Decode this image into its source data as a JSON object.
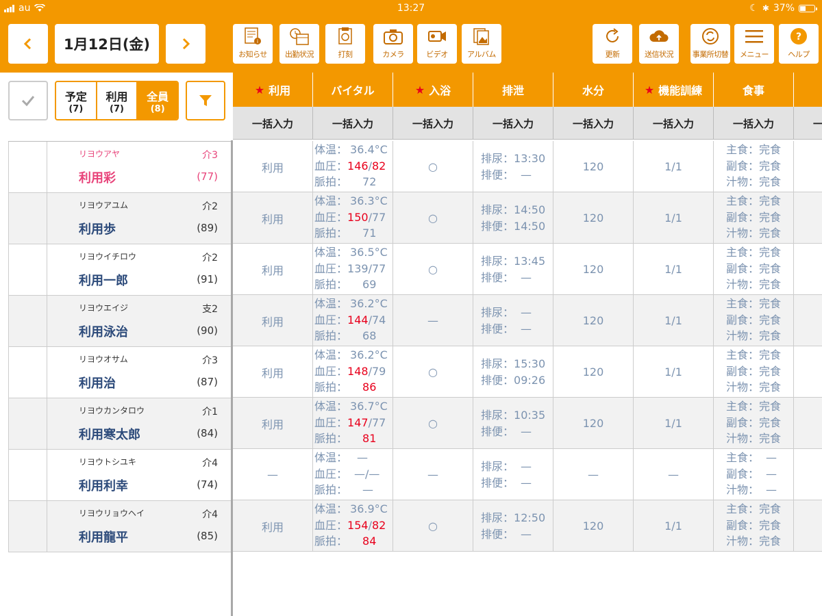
{
  "status": {
    "carrier": "au",
    "time": "13:27",
    "battery": "37%"
  },
  "date": "1月12日(金)",
  "toolbar": {
    "oshirase": "お知らせ",
    "shukkin": "出勤状況",
    "dakoku": "打刻",
    "camera": "カメラ",
    "video": "ビデオ",
    "album": "アルバム",
    "koshin": "更新",
    "soshin": "送信状況",
    "jigyosho": "事業所切替",
    "menu": "メニュー",
    "help": "ヘルプ"
  },
  "filter": {
    "yotei": "予定",
    "yotei_count": "(7)",
    "riyo": "利用",
    "riyo_count": "(7)",
    "zenin": "全員",
    "zenin_count": "(8)"
  },
  "columns": [
    "利用",
    "バイタル",
    "入浴",
    "排泄",
    "水分",
    "機能訓練",
    "食事",
    ""
  ],
  "bulk_label": "一括入力",
  "labels": {
    "taion": "体温：",
    "ketsuatsu": "血圧：",
    "myakuhaku": "脈拍：",
    "hainyo": "排尿：",
    "haiben": "排便：",
    "shushoku": "主食：",
    "fukushoku": "副食：",
    "jiru": "汁物："
  },
  "users": [
    {
      "kana": "リヨウアヤ",
      "care": "介3",
      "name": "利用彩",
      "age": "(77)",
      "use": "利用",
      "temp": "36.4°C",
      "bp_hi": "146",
      "bp_lo": "82",
      "pulse": "72",
      "bath": "○",
      "urine": "13:30",
      "stool": "—",
      "water": "120",
      "training": "1/1",
      "m1": "完食",
      "m2": "完食",
      "m3": "完食"
    },
    {
      "kana": "リヨウアユム",
      "care": "介2",
      "name": "利用歩",
      "age": "(89)",
      "use": "利用",
      "temp": "36.3°C",
      "bp_hi": "150",
      "bp_lo": "77",
      "pulse": "71",
      "bath": "○",
      "urine": "14:50",
      "stool": "14:50",
      "water": "120",
      "training": "1/1",
      "m1": "完食",
      "m2": "完食",
      "m3": "完食"
    },
    {
      "kana": "リヨウイチロウ",
      "care": "介2",
      "name": "利用一郎",
      "age": "(91)",
      "use": "利用",
      "temp": "36.5°C",
      "bp_hi": "139",
      "bp_lo": "77",
      "pulse": "69",
      "bath": "○",
      "urine": "13:45",
      "stool": "—",
      "water": "120",
      "training": "1/1",
      "m1": "完食",
      "m2": "完食",
      "m3": "完食"
    },
    {
      "kana": "リヨウエイジ",
      "care": "支2",
      "name": "利用泳治",
      "age": "(90)",
      "use": "利用",
      "temp": "36.2°C",
      "bp_hi": "144",
      "bp_lo": "74",
      "pulse": "68",
      "bath": "—",
      "urine": "—",
      "stool": "—",
      "water": "120",
      "training": "1/1",
      "m1": "完食",
      "m2": "完食",
      "m3": "完食"
    },
    {
      "kana": "リヨウオサム",
      "care": "介3",
      "name": "利用治",
      "age": "(87)",
      "use": "利用",
      "temp": "36.2°C",
      "bp_hi": "148",
      "bp_lo": "79",
      "pulse": "86",
      "bath": "○",
      "urine": "15:30",
      "stool": "09:26",
      "water": "120",
      "training": "1/1",
      "m1": "完食",
      "m2": "完食",
      "m3": "完食"
    },
    {
      "kana": "リヨウカンタロウ",
      "care": "介1",
      "name": "利用寒太郎",
      "age": "(84)",
      "use": "利用",
      "temp": "36.7°C",
      "bp_hi": "147",
      "bp_lo": "77",
      "pulse": "81",
      "bath": "○",
      "urine": "10:35",
      "stool": "—",
      "water": "120",
      "training": "1/1",
      "m1": "完食",
      "m2": "完食",
      "m3": "完食"
    },
    {
      "kana": "リヨウトシユキ",
      "care": "介4",
      "name": "利用利幸",
      "age": "(74)",
      "use": "—",
      "temp": "—",
      "bp_hi": "—",
      "bp_lo": "—",
      "pulse": "—",
      "bath": "—",
      "urine": "—",
      "stool": "—",
      "water": "—",
      "training": "—",
      "m1": "—",
      "m2": "—",
      "m3": "—"
    },
    {
      "kana": "リヨウリョウヘイ",
      "care": "介4",
      "name": "利用龍平",
      "age": "(85)",
      "use": "利用",
      "temp": "36.9°C",
      "bp_hi": "154",
      "bp_lo": "82",
      "pulse": "84",
      "bath": "○",
      "urine": "12:50",
      "stool": "—",
      "water": "120",
      "training": "1/1",
      "m1": "完食",
      "m2": "完食",
      "m3": "完食"
    }
  ]
}
